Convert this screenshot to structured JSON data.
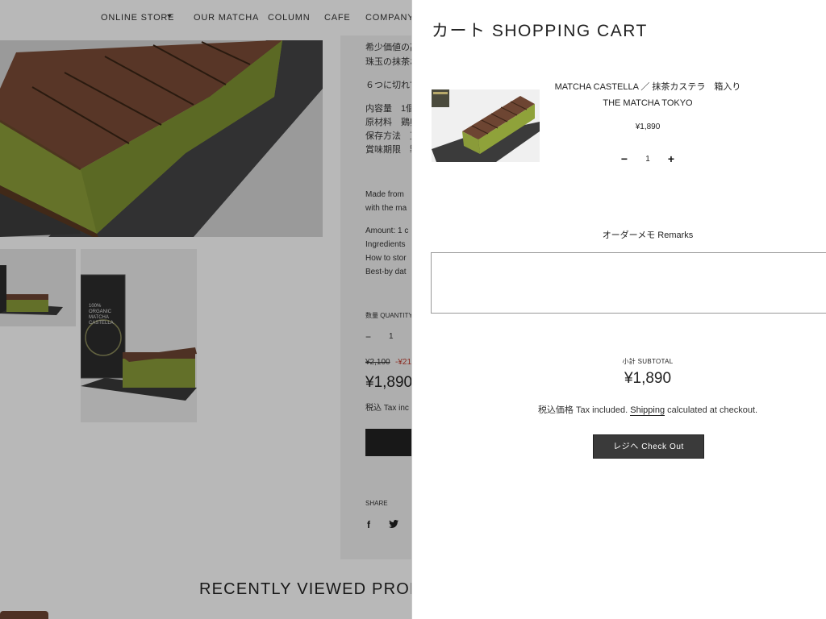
{
  "nav": {
    "items": [
      "ONLINE STORE",
      "OUR MATCHA",
      "COLUMN",
      "CAFE",
      "COMPANY"
    ]
  },
  "product_info": {
    "jp_lines": [
      "希少価値の高",
      "珠玉の抹茶お",
      "６つに切れて"
    ],
    "jp_specs": [
      "内容量　1個",
      "原材料　鶏卵",
      "保存方法　直",
      "賞味期限　製"
    ],
    "en_lines": [
      "Made from",
      "with the ma"
    ],
    "en_specs": [
      "Amount: 1 c",
      "Ingredients",
      "How to stor",
      "Best-by dat"
    ],
    "quantity_label": "数量 QUANTITY",
    "qty_minus": "−",
    "qty_value": "1",
    "original_price": "¥2,100",
    "discount": "-¥21",
    "price": "¥1,890",
    "tax_text": "税込 Tax inc",
    "share_label": "SHARE",
    "recently_viewed": "RECENTLY VIEWED PROD"
  },
  "thumbnail_pkg_text": "100%\nORGANIC\nMATCHA\nCASTELLA",
  "cart": {
    "title": "カート SHOPPING CART",
    "item": {
      "name": "MATCHA CASTELLA ／ 抹茶カステラ　箱入り",
      "brand": "THE MATCHA TOKYO",
      "price": "¥1,890",
      "quantity": "1",
      "minus": "−",
      "plus": "+"
    },
    "remarks_label": "オーダーメモ Remarks",
    "remarks_value": "",
    "subtotal_label": "小計 SUBTOTAL",
    "subtotal_value": "¥1,890",
    "tax_prefix": "税込価格 Tax included. ",
    "shipping_link": "Shipping",
    "tax_suffix": " calculated at checkout.",
    "checkout_label": "レジへ Check Out"
  }
}
